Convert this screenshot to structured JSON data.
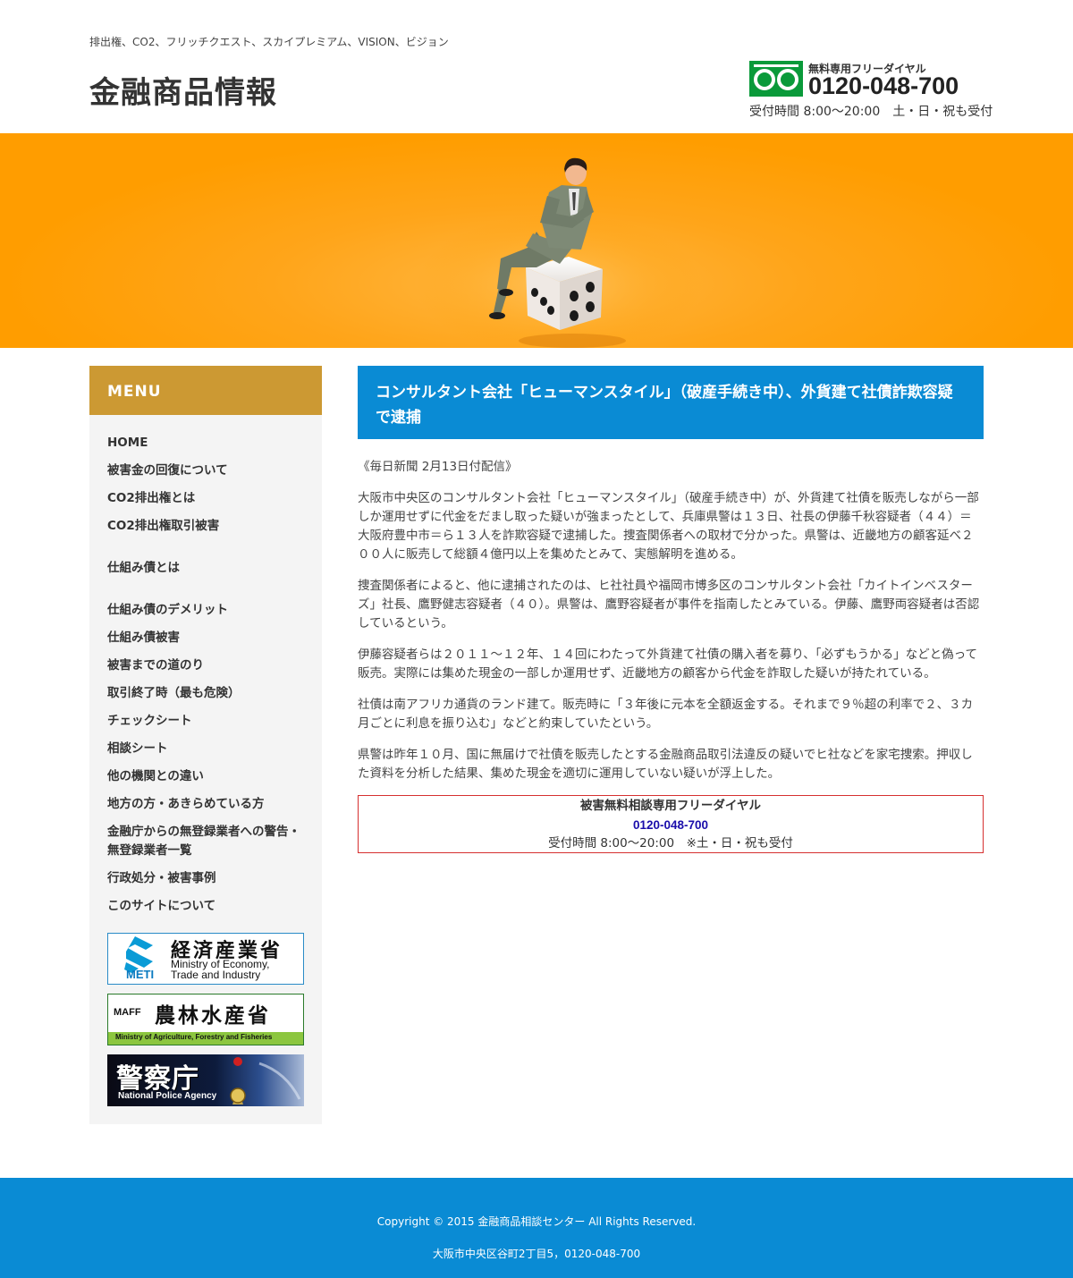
{
  "header": {
    "tagline": "排出権、CO2、フリッチクエスト、スカイプレミアム、VISION、ビジョン",
    "site_title": "金融商品情報",
    "freedial_label": "無料専用フリーダイヤル",
    "freedial_number": "0120-048-700",
    "freedial_hours": "受付時間 8:00〜20:00　土・日・祝も受付"
  },
  "sidebar": {
    "menu_title": "MENU",
    "items": [
      {
        "label": "HOME"
      },
      {
        "label": "被害金の回復について"
      },
      {
        "label": "CO2排出権とは"
      },
      {
        "label": "CO2排出権取引被害"
      },
      {
        "label": "仕組み債とは"
      },
      {
        "label": "仕組み債のデメリット"
      },
      {
        "label": "仕組み債被害"
      },
      {
        "label": "被害までの道のり"
      },
      {
        "label": "取引終了時（最も危険）"
      },
      {
        "label": "チェックシート"
      },
      {
        "label": "相談シート"
      },
      {
        "label": "他の機関との違い"
      },
      {
        "label": "地方の方・あきらめている方"
      },
      {
        "label": "金融庁からの無登録業者への警告・無登録業者一覧"
      },
      {
        "label": "行政処分・被害事例"
      },
      {
        "label": "このサイトについて"
      }
    ],
    "badges": {
      "meti": {
        "jp": "経済産業省",
        "abbr": "METI",
        "en1": "Ministry of Economy,",
        "en2": "Trade and Industry"
      },
      "maff": {
        "abbr": "MAFF",
        "jp": "農林水産省",
        "en": "Ministry of Agriculture, Forestry and Fisheries"
      },
      "npa": {
        "jp": "警察庁",
        "en": "National Police Agency"
      }
    }
  },
  "article": {
    "title": "コンサルタント会社「ヒューマンスタイル」（破産手続き中）、外貨建て社債詐欺容疑で逮捕",
    "source": "《毎日新聞 2月13日付配信》",
    "paragraphs": [
      "大阪市中央区のコンサルタント会社「ヒューマンスタイル」（破産手続き中）が、外貨建て社債を販売しながら一部しか運用せずに代金をだまし取った疑いが強まったとして、兵庫県警は１３日、社長の伊藤千秋容疑者（４４）＝大阪府豊中市＝ら１３人を詐欺容疑で逮捕した。捜査関係者への取材で分かった。県警は、近畿地方の顧客延べ２００人に販売して総額４億円以上を集めたとみて、実態解明を進める。",
      "捜査関係者によると、他に逮捕されたのは、ヒ社社員や福岡市博多区のコンサルタント会社「カイトインベスターズ」社長、鷹野健志容疑者（４０）。県警は、鷹野容疑者が事件を指南したとみている。伊藤、鷹野両容疑者は否認しているという。",
      "伊藤容疑者らは２０１１〜１２年、１４回にわたって外貨建て社債の購入者を募り、「必ずもうかる」などと偽って販売。実際には集めた現金の一部しか運用せず、近畿地方の顧客から代金を詐取した疑いが持たれている。",
      "社債は南アフリカ通貨のランド建て。販売時に「３年後に元本を全額返金する。それまで９％超の利率で２、３カ月ごとに利息を振り込む」などと約束していたという。",
      "県警は昨年１０月、国に無届けで社債を販売したとする金融商品取引法違反の疑いでヒ社などを家宅捜索。押収した資料を分析した結果、集めた現金を適切に運用していない疑いが浮上した。"
    ]
  },
  "consult": {
    "title": "被害無料相談専用フリーダイヤル",
    "number": "0120-048-700",
    "hours": "受付時間 8:00〜20:00　※土・日・祝も受付"
  },
  "footer": {
    "copyright": "Copyright © 2015 金融商品相談センター All Rights Reserved.",
    "address": "大阪市中央区谷町2丁目5，0120-048-700"
  }
}
